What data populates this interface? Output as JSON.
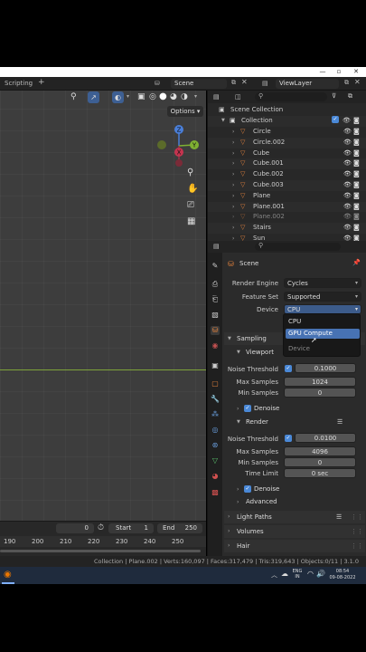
{
  "topbar": {
    "workspace_tab": "Scripting",
    "scene_name": "Scene",
    "view_layer": "ViewLayer"
  },
  "viewport": {
    "options_label": "Options",
    "gizmo_labels": {
      "z": "Z",
      "y": "Y",
      "x": "X"
    }
  },
  "timeline": {
    "current_frame": "0",
    "start_label": "Start",
    "start_value": "1",
    "end_label": "End",
    "end_value": "250",
    "ruler": [
      "190",
      "200",
      "210",
      "220",
      "230",
      "240",
      "250"
    ]
  },
  "outliner": {
    "root": "Scene Collection",
    "collection": "Collection",
    "items": [
      {
        "name": "Circle"
      },
      {
        "name": "Circle.002"
      },
      {
        "name": "Cube"
      },
      {
        "name": "Cube.001"
      },
      {
        "name": "Cube.002"
      },
      {
        "name": "Cube.003"
      },
      {
        "name": "Plane"
      },
      {
        "name": "Plane.001"
      },
      {
        "name": "Plane.002"
      },
      {
        "name": "Stairs"
      },
      {
        "name": "Sun"
      }
    ]
  },
  "properties": {
    "context": "Scene",
    "render_engine_label": "Render Engine",
    "render_engine_value": "Cycles",
    "feature_set_label": "Feature Set",
    "feature_set_value": "Supported",
    "device_label": "Device",
    "device_value": "CPU",
    "device_options": [
      "CPU",
      "GPU Compute"
    ],
    "device_hint": "Device",
    "sampling": "Sampling",
    "viewport": "Viewport",
    "vp_noise_label": "Noise Threshold",
    "vp_noise_value": "0.1000",
    "vp_max_label": "Max Samples",
    "vp_max_value": "1024",
    "vp_min_label": "Min Samples",
    "vp_min_value": "0",
    "denoise": "Denoise",
    "render": "Render",
    "r_noise_label": "Noise Threshold",
    "r_noise_value": "0.0100",
    "r_max_label": "Max Samples",
    "r_max_value": "4096",
    "r_min_label": "Min Samples",
    "r_min_value": "0",
    "time_limit_label": "Time Limit",
    "time_limit_value": "0 sec",
    "denoise2": "Denoise",
    "advanced": "Advanced",
    "light_paths": "Light Paths",
    "volumes": "Volumes",
    "hair": "Hair"
  },
  "statusbar": {
    "text": "Collection | Plane.002 | Verts:160,097 | Faces:317,479 | Tris:319,643 | Objects:0/11 | 3.1.0"
  },
  "taskbar": {
    "lang1": "ENG",
    "lang2": "IN",
    "time": "08:54",
    "date": "09-08-2022"
  },
  "colors": {
    "accent": "#4a88d6",
    "object_orange": "#e0803c",
    "mesh_green": "#5cc56f"
  }
}
